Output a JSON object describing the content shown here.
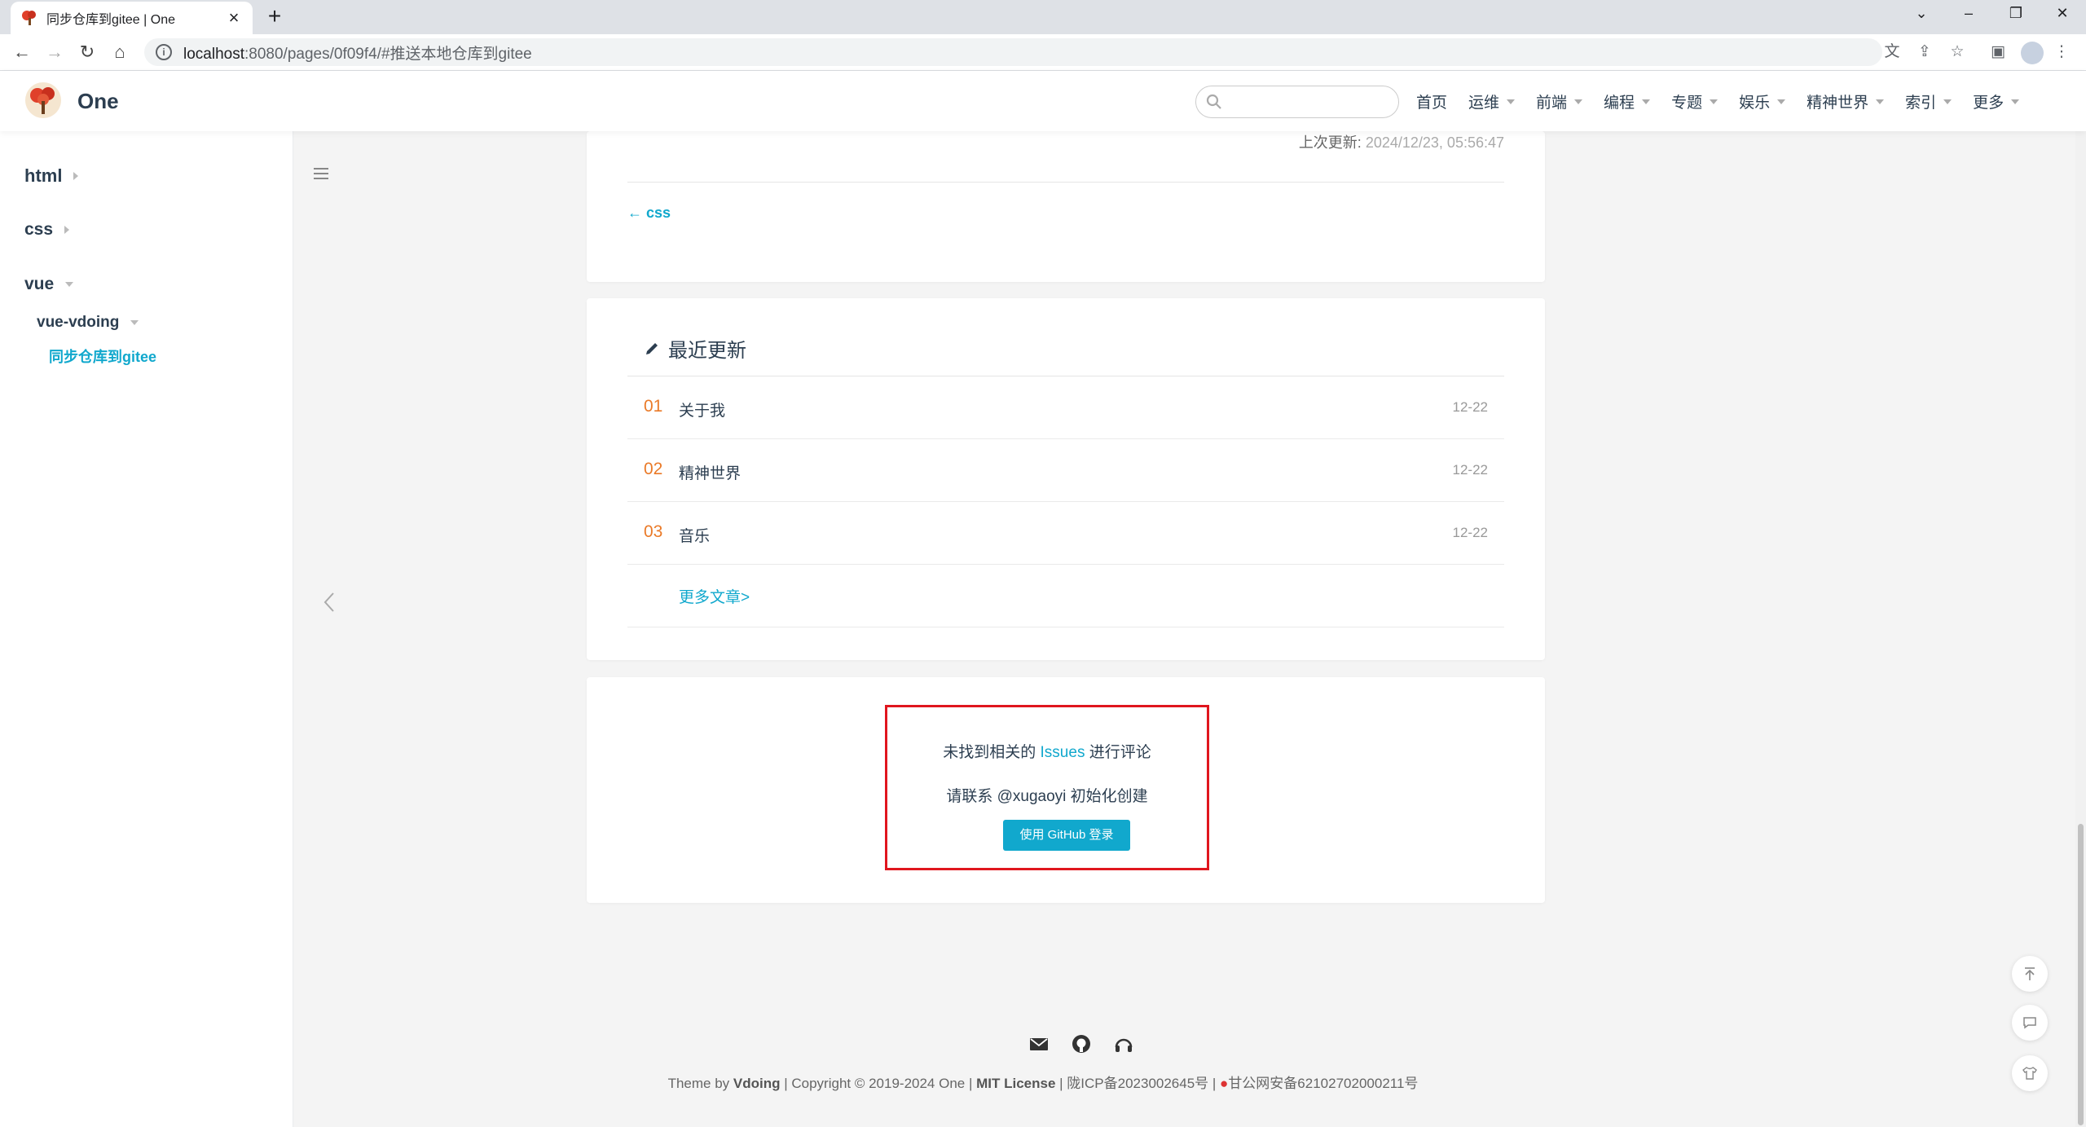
{
  "browser": {
    "tab_title": "同步仓库到gitee | One",
    "url_host": "localhost",
    "url_path": ":8080/pages/0f09f4/#推送本地仓库到gitee"
  },
  "navbar": {
    "site_name": "One",
    "search_placeholder": "",
    "items": [
      {
        "label": "首页",
        "dropdown": false
      },
      {
        "label": "运维",
        "dropdown": true
      },
      {
        "label": "前端",
        "dropdown": true
      },
      {
        "label": "编程",
        "dropdown": true
      },
      {
        "label": "专题",
        "dropdown": true
      },
      {
        "label": "娱乐",
        "dropdown": true
      },
      {
        "label": "精神世界",
        "dropdown": true
      },
      {
        "label": "索引",
        "dropdown": true
      },
      {
        "label": "更多",
        "dropdown": true
      }
    ]
  },
  "sidebar": {
    "groups": [
      "html",
      "css",
      "vue"
    ],
    "sub_group": "vue-vdoing",
    "active_page": "同步仓库到gitee"
  },
  "article": {
    "last_updated_label": "上次更新:",
    "last_updated": "2024/12/23, 05:56:47",
    "prev_link": "← css"
  },
  "recent": {
    "title": "最近更新",
    "items": [
      {
        "num": "01",
        "name": "关于我",
        "date": "12-22"
      },
      {
        "num": "02",
        "name": "精神世界",
        "date": "12-22"
      },
      {
        "num": "03",
        "name": "音乐",
        "date": "12-22"
      }
    ],
    "more": "更多文章>"
  },
  "comments": {
    "line1_pre": "未找到相关的 ",
    "line1_link": "Issues",
    "line1_post": " 进行评论",
    "line2": "请联系 @xugaoyi 初始化创建",
    "button": "使用 GitHub 登录"
  },
  "footer": {
    "theme_by": "Theme by ",
    "vdoing": "Vdoing",
    "copyright": " | Copyright © 2019-2024 One | ",
    "license": "MIT License",
    "icp": " | 陇ICP备2023002645号 | ",
    "police": "甘公网安备62102702000211号"
  },
  "colors": {
    "accent": "#11a8cd",
    "number": "#ea7a28",
    "highlight_box": "#e0161e"
  }
}
